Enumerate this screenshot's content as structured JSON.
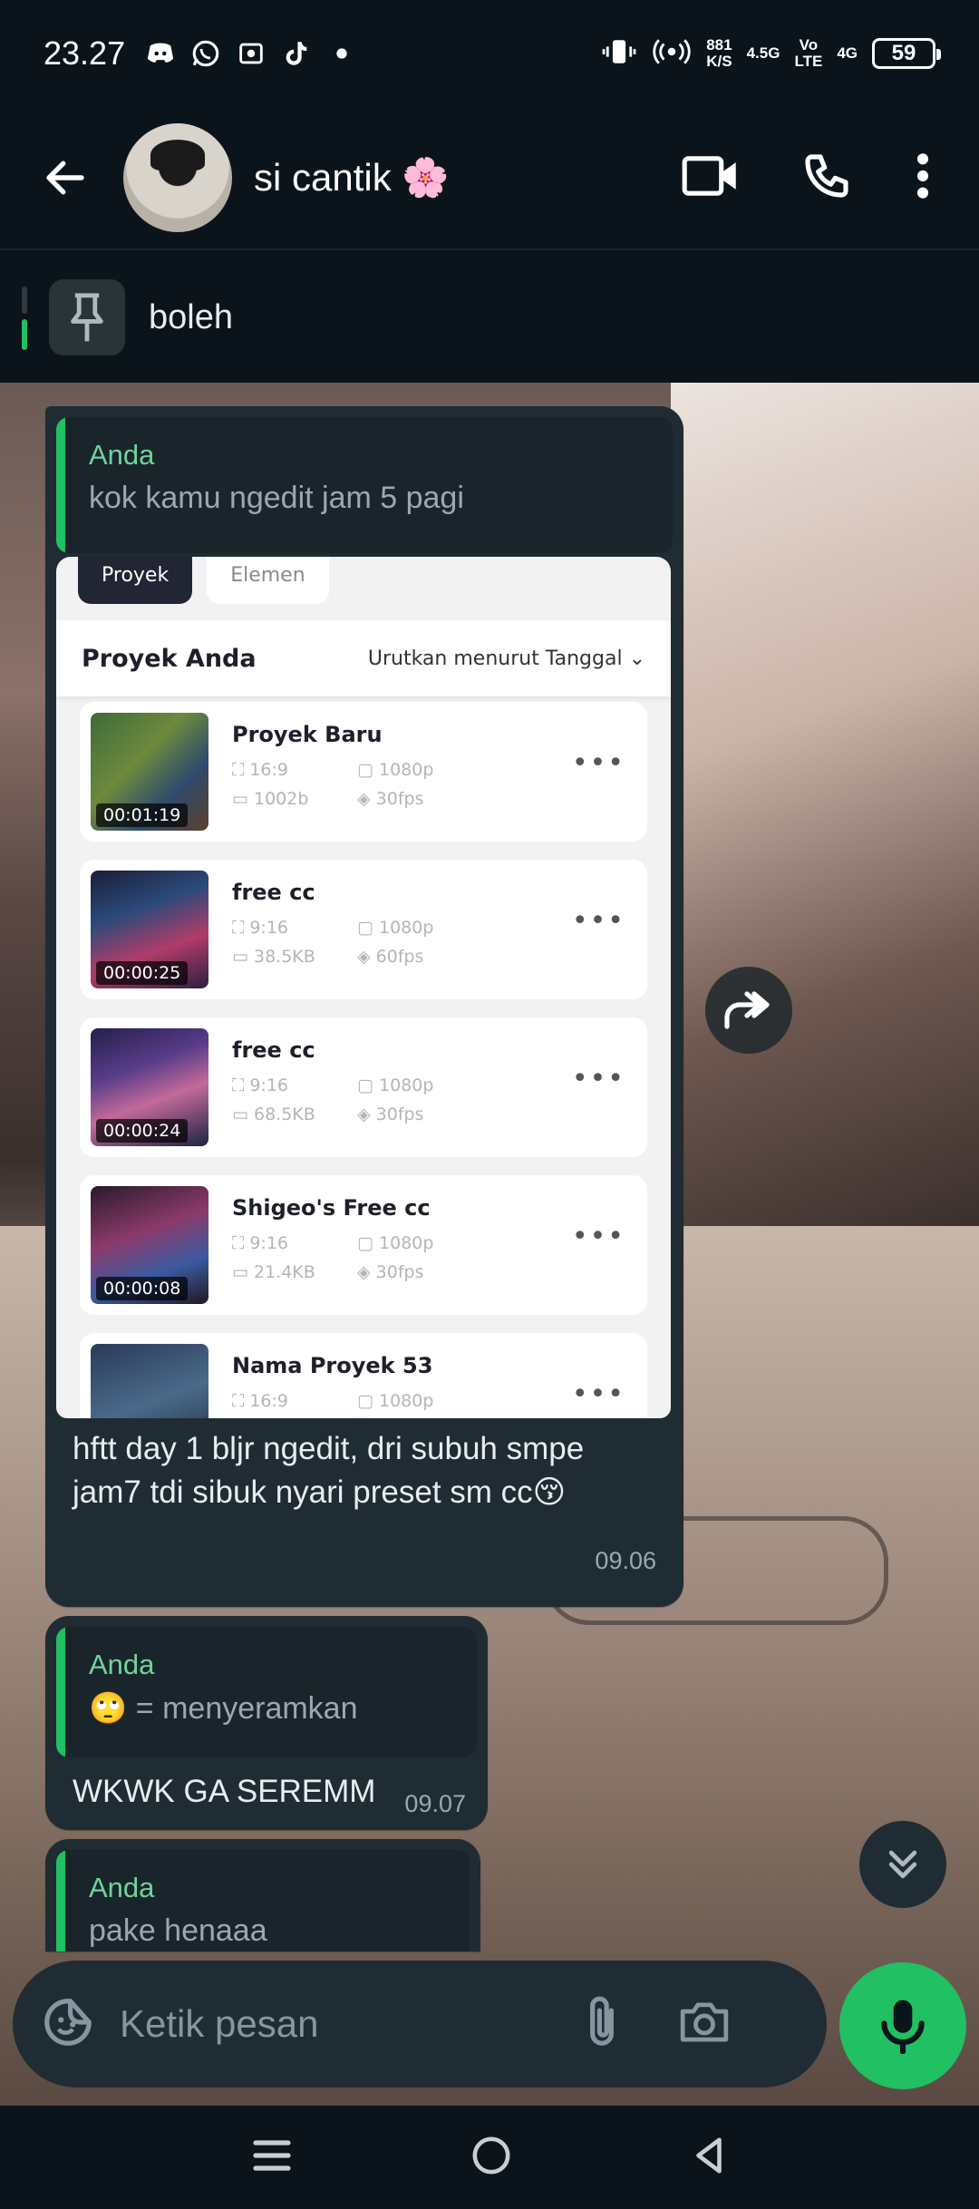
{
  "status_bar": {
    "time": "23.27",
    "speed": "881",
    "speed_unit": "K/S",
    "net1": "4.5G",
    "net2_top": "Vo",
    "net2_bottom": "LTE",
    "net3": "4G",
    "battery": "59"
  },
  "header": {
    "contact_name": "si cantik 🌸"
  },
  "pinned": {
    "text": "boleh"
  },
  "messages": [
    {
      "quote_name": "Anda",
      "quote_text": "kok kamu ngedit jam 5 pagi",
      "screenshot": {
        "tabs": [
          "Proyek",
          "Elemen"
        ],
        "section_title": "Proyek Anda",
        "sort_label": "Urutkan menurut Tanggal",
        "projects": [
          {
            "name": "Proyek Baru",
            "duration": "00:01:19",
            "ratio": "16:9",
            "size": "1002b",
            "res": "1080p",
            "fps": "30fps"
          },
          {
            "name": "free cc",
            "duration": "00:00:25",
            "ratio": "9:16",
            "size": "38.5KB",
            "res": "1080p",
            "fps": "60fps"
          },
          {
            "name": "free cc",
            "duration": "00:00:24",
            "ratio": "9:16",
            "size": "68.5KB",
            "res": "1080p",
            "fps": "30fps"
          },
          {
            "name": "Shigeo's Free cc",
            "duration": "00:00:08",
            "ratio": "9:16",
            "size": "21.4KB",
            "res": "1080p",
            "fps": "30fps"
          },
          {
            "name": "Nama Proyek 53",
            "duration": "",
            "ratio": "16:9",
            "size": "",
            "res": "1080p",
            "fps": ""
          }
        ]
      },
      "body": "hftt day 1 bljr ngedit, dri subuh smpe jam7 tdi sibuk nyari preset sm cc😚",
      "time": "09.06"
    },
    {
      "quote_name": "Anda",
      "quote_text": "🙄 = menyeramkan",
      "body": "WKWK GA SEREMM",
      "time": "09.07"
    },
    {
      "quote_name": "Anda",
      "quote_text": "pake henaaa"
    }
  ],
  "composer": {
    "placeholder": "Ketik pesan"
  },
  "colors": {
    "accent": "#21c063",
    "bubble": "#1f2c34",
    "background": "#0b141a",
    "quote_name": "#6fd39c"
  }
}
